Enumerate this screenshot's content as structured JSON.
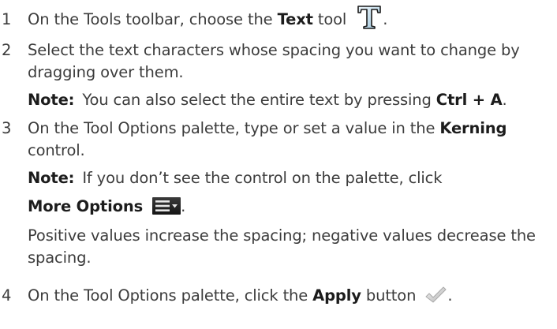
{
  "steps": [
    {
      "number": "1",
      "pre": "On the Tools toolbar, choose the ",
      "bold": "Text",
      "post": " tool",
      "tail": "."
    },
    {
      "number": "2",
      "line1": "Select the text characters whose spacing you want to change by",
      "line2": "dragging over them.",
      "note_label": "Note:",
      "note_pre": "You can also select the entire text by pressing ",
      "note_keys": "Ctrl + A",
      "note_post": "."
    },
    {
      "number": "3",
      "pre": "On the Tool Options palette, type or set a value in the ",
      "bold": "Kerning",
      "line2": "control.",
      "note_label": "Note:",
      "note_text": "If you don’t see the control on the palette, click",
      "more_label": "More Options",
      "more_tail": ".",
      "para_line1": "Positive values increase the spacing; negative values decrease the",
      "para_line2": "spacing."
    },
    {
      "number": "4",
      "pre": "On the Tool Options palette, click the ",
      "bold": "Apply",
      "post": " button",
      "tail": "."
    }
  ],
  "icons": {
    "text_tool": "text-tool-icon",
    "more_options": "more-options-icon",
    "apply": "apply-checkmark-icon"
  }
}
